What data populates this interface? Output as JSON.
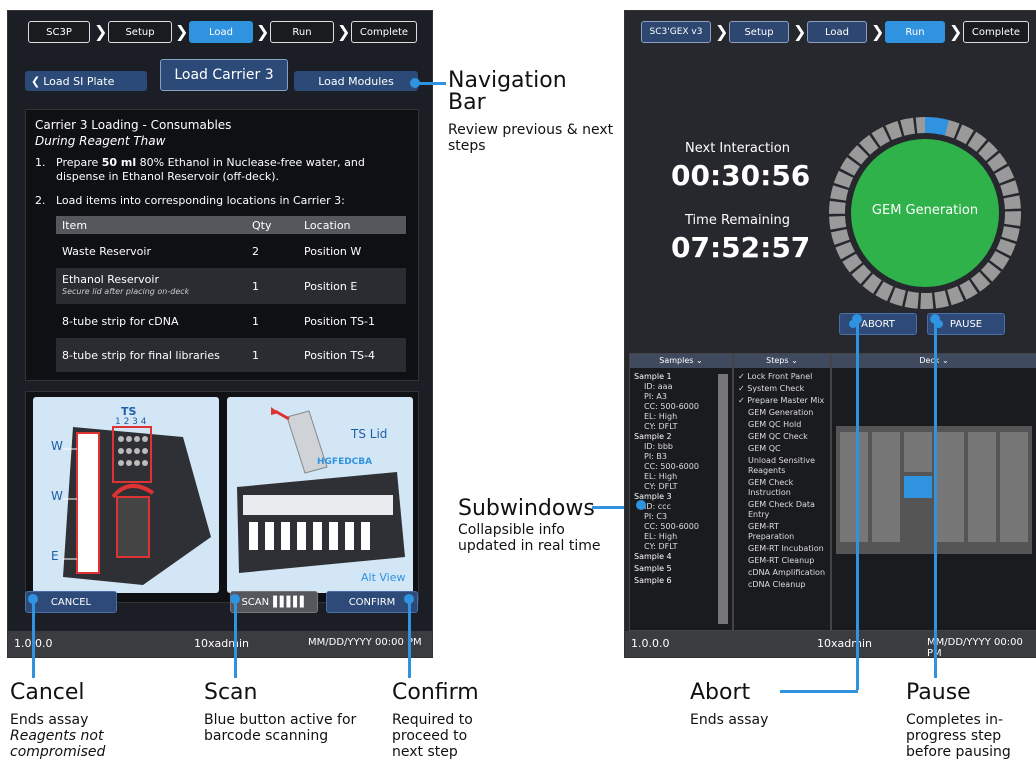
{
  "left_screen": {
    "breadcrumb": [
      "SC3P",
      "Setup",
      "Load",
      "Run",
      "Complete"
    ],
    "nav": {
      "prev": "Load SI Plate",
      "current": "Load Carrier 3",
      "next": "Load Modules"
    },
    "heading": "Carrier 3 Loading - Consumables",
    "subheading": "During Reagent Thaw",
    "step1": {
      "num": "1.",
      "pre": "Prepare ",
      "bold": "50 ml",
      "post": " 80% Ethanol in Nuclease-free water, and dispense in Ethanol Reservoir (off-deck)."
    },
    "step2": {
      "num": "2.",
      "text": "Load items into corresponding locations in Carrier 3:"
    },
    "table": {
      "headers": [
        "Item",
        "Qty",
        "Location"
      ],
      "rows": [
        {
          "item": "Waste Reservoir",
          "note": "",
          "qty": "2",
          "loc": "Position W"
        },
        {
          "item": "Ethanol Reservoir",
          "note": "Secure lid after placing on-deck",
          "qty": "1",
          "loc": "Position E"
        },
        {
          "item": "8-tube strip for cDNA",
          "note": "",
          "qty": "1",
          "loc": "Position TS-1"
        },
        {
          "item": "8-tube strip for final libraries",
          "note": "",
          "qty": "1",
          "loc": "Position TS-4"
        }
      ]
    },
    "diagram": {
      "ts": "TS",
      "ts_nums": "1 2 3 4",
      "w1": "W",
      "w2": "W",
      "e": "E",
      "tslid": "TS Lid",
      "letters": "HGFEDCBA",
      "altview": "Alt View"
    },
    "buttons": {
      "cancel": "CANCEL",
      "scan": "SCAN",
      "confirm": "CONFIRM"
    },
    "status": {
      "version": "1.0.0.0",
      "user": "10xadmin",
      "date": "MM/DD/YYYY 00:00 PM"
    }
  },
  "right_screen": {
    "breadcrumb": [
      "SC3'GEX v3",
      "Setup",
      "Load",
      "Run",
      "Complete"
    ],
    "next_label": "Next Interaction",
    "next_time": "00:30:56",
    "remain_label": "Time Remaining",
    "remain_time": "07:52:57",
    "gem_label": "GEM Generation",
    "progress": 0.04,
    "buttons": {
      "abort": "ABORT",
      "pause": "PAUSE"
    },
    "subwindows": {
      "samples": "Samples ⌄",
      "steps": "Steps ⌄",
      "deck": "Deck ⌄"
    },
    "samples": [
      {
        "name": "Sample 1",
        "lines": [
          "ID: aaa",
          "PI: A3",
          "CC: 500-6000",
          "EL: High",
          "CY: DFLT"
        ]
      },
      {
        "name": "Sample 2",
        "lines": [
          "ID: bbb",
          "PI: B3",
          "CC: 500-6000",
          "EL: High",
          "CY: DFLT"
        ]
      },
      {
        "name": "Sample 3",
        "lines": [
          "ID: ccc",
          "PI: C3",
          "CC: 500-6000",
          "EL: High",
          "CY: DFLT"
        ]
      },
      {
        "name": "Sample 4",
        "lines": []
      },
      {
        "name": "Sample 5",
        "lines": []
      },
      {
        "name": "Sample 6",
        "lines": []
      }
    ],
    "steps": [
      "✓ Lock Front Panel",
      "✓ System Check",
      "✓ Prepare Master Mix",
      "GEM Generation",
      "GEM QC Hold",
      "GEM QC Check",
      "GEM QC",
      "Unload Sensitive Reagents",
      "GEM Check Instruction",
      "GEM Check Data Entry",
      "GEM-RT Preparation",
      "GEM-RT Incubation",
      "GEM-RT Cleanup",
      "cDNA Amplification",
      "cDNA Cleanup"
    ],
    "status": {
      "version": "1.0.0.0",
      "user": "10xadmin",
      "date": "MM/DD/YYYY 00:00 PM"
    }
  },
  "annotations": {
    "nav": {
      "title": "Navigation Bar",
      "desc": "Review previous & next steps"
    },
    "sub": {
      "title": "Subwindows",
      "desc": "Collapsible info updated in real time"
    },
    "cancel": {
      "title": "Cancel",
      "desc": "Ends assay",
      "italic": "Reagents not compromised"
    },
    "scan": {
      "title": "Scan",
      "desc": "Blue button active for barcode scanning"
    },
    "confirm": {
      "title": "Confirm",
      "desc": "Required to proceed to next step"
    },
    "abort": {
      "title": "Abort",
      "desc": "Ends assay"
    },
    "pause": {
      "title": "Pause",
      "desc": "Completes in-progress step before pausing"
    }
  },
  "colors": {
    "accent": "#2f93e0",
    "navy": "#2c4a78",
    "gem_green": "#2fb24a"
  }
}
